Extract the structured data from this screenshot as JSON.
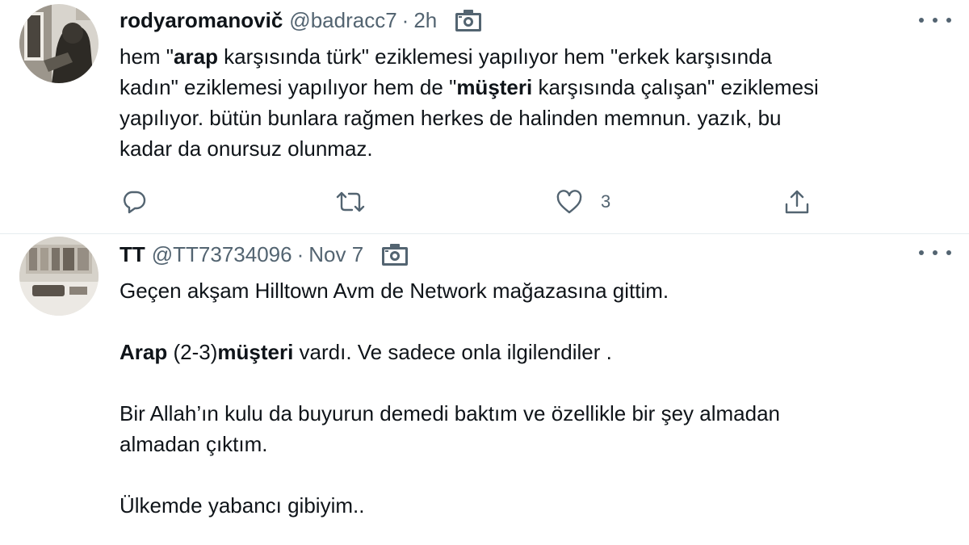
{
  "tweets": [
    {
      "author_name": "rodyaromanovič",
      "handle": "@badracc7",
      "separator": "·",
      "time": "2h",
      "body_segments": [
        {
          "text": "hem \"",
          "bold": false
        },
        {
          "text": "arap",
          "bold": true
        },
        {
          "text": " karşısında türk\" eziklemesi yapılıyor hem \"erkek karşısında",
          "bold": false
        },
        {
          "text": "kadın\" eziklemesi yapılıyor hem de \"",
          "bold": false
        },
        {
          "text": "müşteri",
          "bold": true
        },
        {
          "text": " karşısında çalışan\" eziklemesi",
          "bold": false
        },
        {
          "text": "yapılıyor. bütün bunlara rağmen herkes de halinden memnun. yazık, bu",
          "bold": false
        },
        {
          "text": "kadar da onursuz olunmaz.",
          "bold": false
        }
      ],
      "like_count": "3",
      "icons": {
        "camera": "camera-icon",
        "more": "more-options-icon",
        "reply": "reply-icon",
        "retweet": "retweet-icon",
        "like": "like-icon",
        "share": "share-icon"
      }
    },
    {
      "author_name": "TT",
      "handle": "@TT73734096",
      "separator": "·",
      "time": "Nov 7",
      "paragraphs": [
        {
          "text": "Geçen akşam Hilltown Avm de Network mağazasına gittim."
        },
        {
          "bold_1": "Arap",
          "text_1": " (2-3)",
          "bold_2": "müşteri",
          "text_2": " vardı. Ve sadece onla ilgilendiler ."
        },
        {
          "line_1": "Bir Allah’ın kulu da buyurun demedi baktım ve özellikle bir şey almadan",
          "line_2": "almadan çıktım."
        },
        {
          "text": "Ülkemde yabancı gibiyim.."
        }
      ]
    }
  ],
  "colors": {
    "text_primary": "#0f1419",
    "text_secondary": "#536471",
    "divider": "#e6ecf0"
  }
}
